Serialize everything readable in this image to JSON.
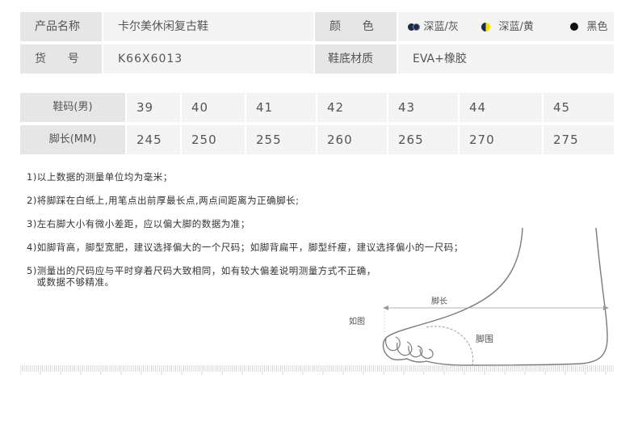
{
  "info": {
    "name_label": "产品名称",
    "name_value": "卡尔美休闲复古鞋",
    "color_label": "颜      色",
    "colors": [
      {
        "label": "深蓝/灰",
        "dot1": "#1f2a4d",
        "dot2": "#8a8fa0"
      },
      {
        "label": "深蓝/黄",
        "dot1": "#1f2a4d",
        "dot2": "#f5e400"
      },
      {
        "label": "黑色",
        "dot1": "#111111"
      }
    ],
    "sku_label": "货      号",
    "sku_value": "K66X6013",
    "sole_label": "鞋底材质",
    "sole_value": "EVA+橡胶"
  },
  "sizes": {
    "size_label": "鞋码(男)",
    "length_label": "脚长(MM)",
    "size_values": [
      "39",
      "40",
      "41",
      "42",
      "43",
      "44",
      "45"
    ],
    "length_values": [
      "245",
      "250",
      "255",
      "260",
      "265",
      "270",
      "275"
    ]
  },
  "notes": [
    "1)以上数据的测量单位均为毫米；",
    "2)将脚踩在白纸上,用笔点出前厚最长点,两点间距离为正确脚长;",
    "3)左右脚大小有微小差距，应以偏大脚的数据为准；",
    "4)如脚背高，脚型宽肥，建议选择偏大的一个尺码；如脚背扁平，脚型纤瘦，建议选择偏小的一尺码；",
    "5)测量出的尺码应与平时穿着尺码大致相同，如有较大偏差说明测量方式不正确，",
    "   或数据不够精准。"
  ],
  "diagram": {
    "foot_length_label": "脚长",
    "as_shown_label": "如图",
    "girth_label": "脚围"
  }
}
